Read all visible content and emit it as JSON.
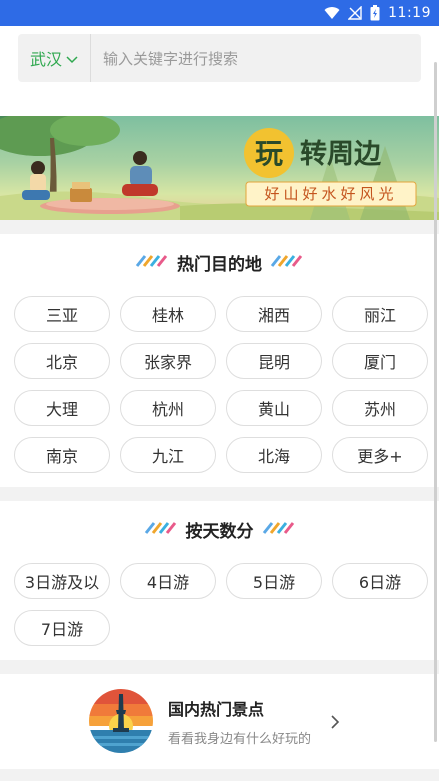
{
  "statusbar": {
    "time": "11:19",
    "icons": [
      "wifi-icon",
      "signal-off-icon",
      "battery-icon"
    ]
  },
  "search": {
    "city": "武汉",
    "placeholder": "输入关键字进行搜索"
  },
  "banner": {
    "title_char": "玩",
    "title_rest": "转周边",
    "subtitle": "好山好水好风光"
  },
  "hot": {
    "title": "热门目的地",
    "items": [
      "三亚",
      "桂林",
      "湘西",
      "丽江",
      "北京",
      "张家界",
      "昆明",
      "厦门",
      "大理",
      "杭州",
      "黄山",
      "苏州",
      "南京",
      "九江",
      "北海",
      "更多+"
    ]
  },
  "days": {
    "title": "按天数分",
    "items": [
      "3日游及以",
      "4日游",
      "5日游",
      "6日游",
      "7日游"
    ]
  },
  "domestic": {
    "title": "国内热门景点",
    "subtitle": "看看我身边有什么好玩的"
  },
  "colors": {
    "statusbar": "#2e6be6",
    "accent": "#2fa84f",
    "banner_gold": "#f2c230"
  }
}
